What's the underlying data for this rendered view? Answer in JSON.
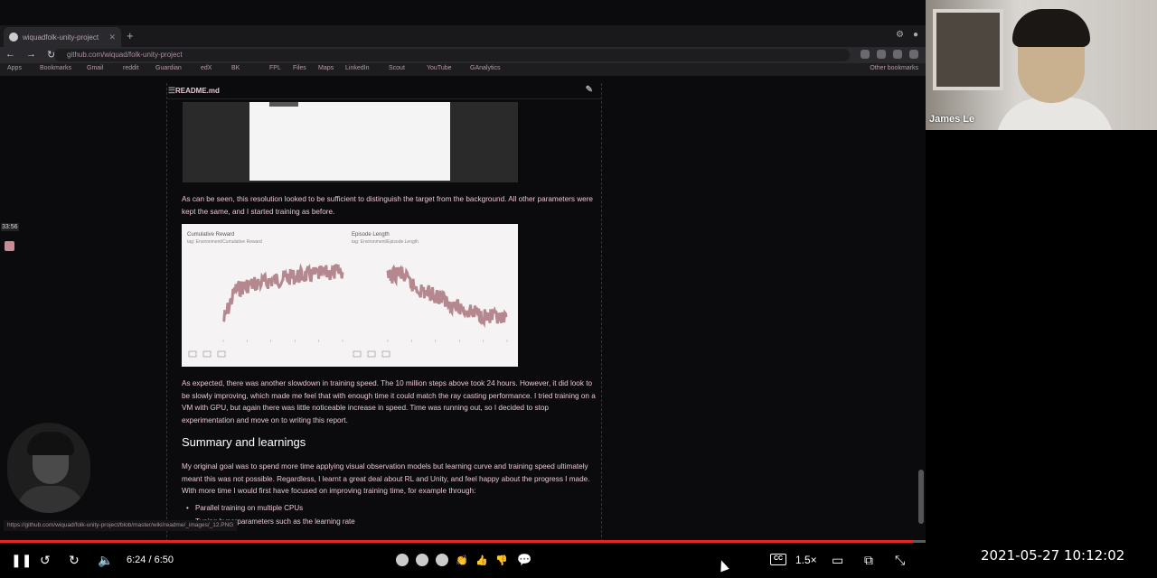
{
  "browser": {
    "tab_title": "wiquadfolk-unity-project",
    "url": "github.com/wiquad/folk-unity-project",
    "bookmarks": [
      "Apps",
      "Bookmarks",
      "Gmail",
      "reddit",
      "Guardian",
      "edX",
      "BK",
      "FPL",
      "Files",
      "Maps",
      "LinkedIn",
      "Scout",
      "YouTube",
      "GAnalytics"
    ],
    "other_bookmarks": "Other bookmarks",
    "status_url": "https://github.com/wiquad/folk-unity-project/blob/master/wiki/readme/_images/_12.PNG"
  },
  "readme": {
    "filename": "README.md",
    "para1": "As can be seen, this resolution looked to be sufficient to distinguish the target from the background. All other parameters were kept the same, and I started training as before.",
    "para2": "As expected, there was another slowdown in training speed. The 10 million steps above took 24 hours. However, it did look to be slowly improving, which made me feel that with enough time it could match the ray casting performance. I tried training on a VM with GPU, but again there was little noticeable increase in speed. Time was running out, so I decided to stop experimentation and move on to writing this report.",
    "heading": "Summary and learnings",
    "para3": "My original goal was to spend more time applying visual observation models but learning curve and training speed ultimately meant this was not possible. Regardless, I learnt a great deal about RL and Unity, and feel happy about the progress I made. With more time I would first have focused on improving training time, for example through:",
    "bullets": [
      "Parallel training on multiple CPUs",
      "Tuning hyperparameters such as the learning rate"
    ]
  },
  "chart_data": [
    {
      "type": "line",
      "title": "Cumulative Reward",
      "subtitle": "tag: Environment/Cumulative Reward",
      "x": [
        0,
        1,
        2,
        3,
        4,
        5,
        6,
        7,
        8,
        9,
        10
      ],
      "series": [
        {
          "values": [
            -0.6,
            0.1,
            0.2,
            0.25,
            0.3,
            0.35,
            0.4,
            0.42,
            0.45,
            0.48,
            0.5
          ]
        }
      ],
      "color": "#a8747b"
    },
    {
      "type": "line",
      "title": "Episode Length",
      "subtitle": "tag: Environment/Episode Length",
      "x": [
        0,
        1,
        2,
        3,
        4,
        5,
        6,
        7,
        8,
        9,
        10
      ],
      "series": [
        {
          "values": [
            950,
            960,
            940,
            930,
            925,
            915,
            905,
            900,
            895,
            890,
            885
          ]
        }
      ],
      "color": "#a8747b"
    }
  ],
  "sidebar": {
    "time_badge": "33:56"
  },
  "webcam": {
    "name": "James Le"
  },
  "player": {
    "time": "6:24 / 6:50",
    "progress": 0.985,
    "speed": "1.5×",
    "cc": "CC"
  },
  "clock": "2021-05-27  10:12:02",
  "colors": {
    "accent": "#e52626",
    "text": "#e6c6d4"
  }
}
